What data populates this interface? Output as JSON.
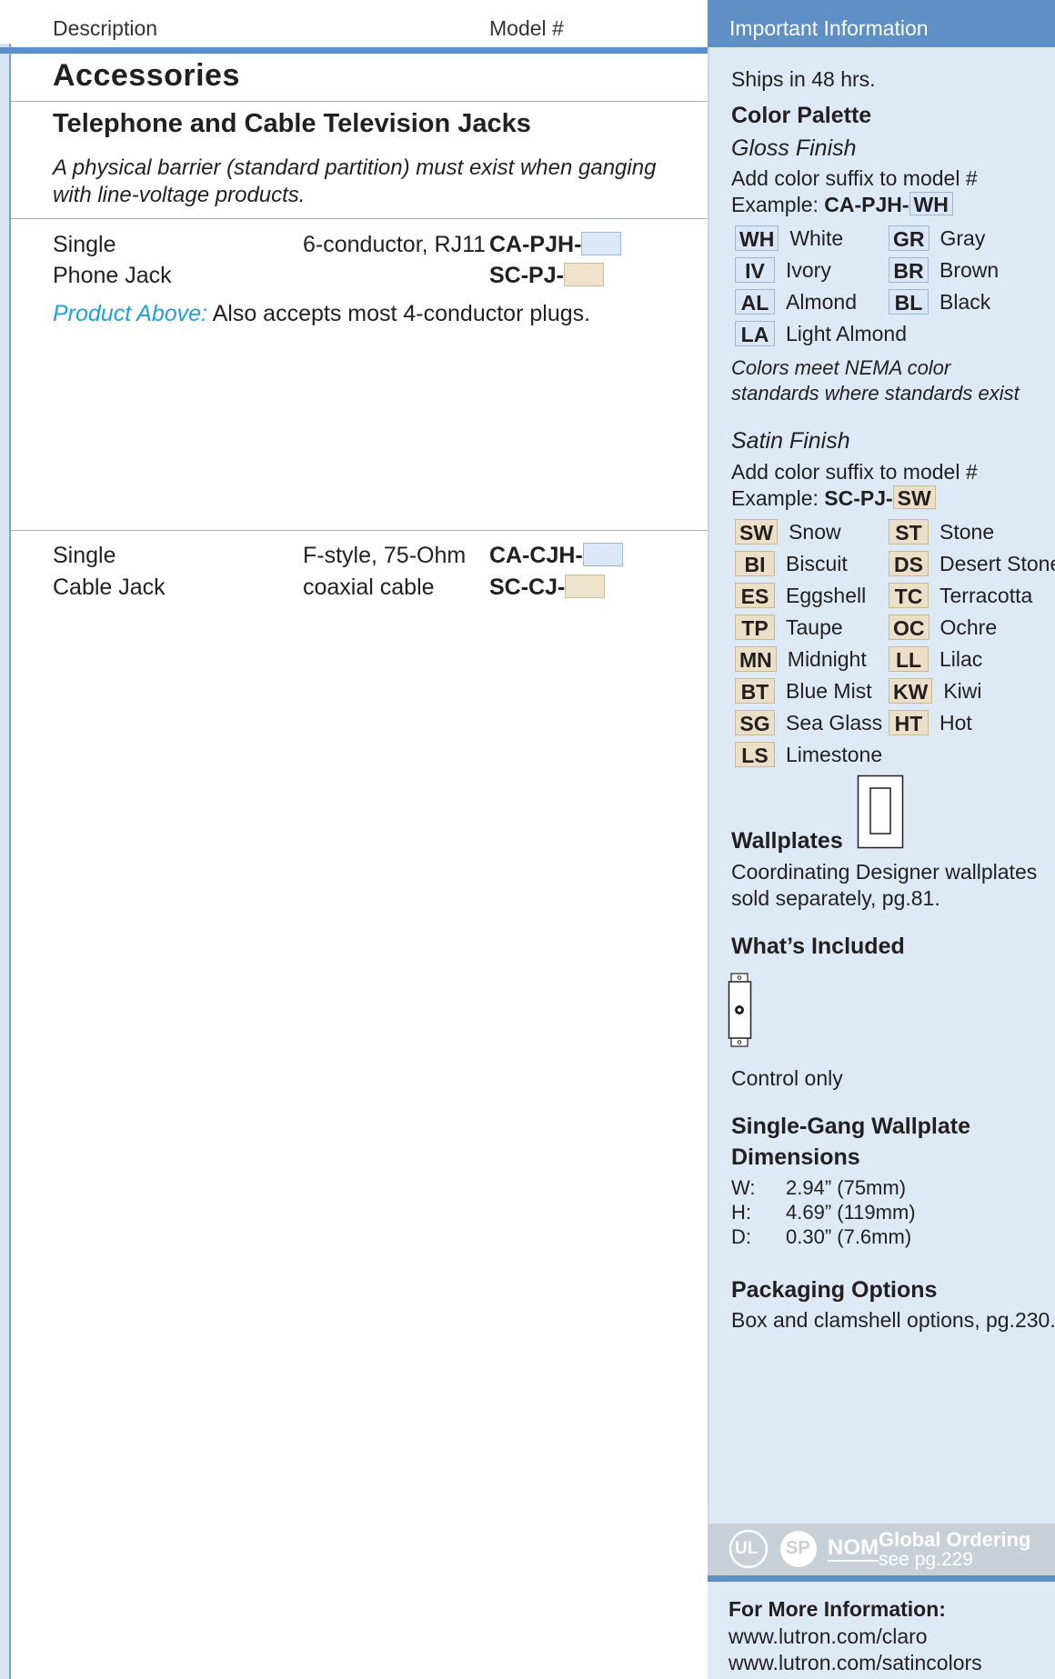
{
  "header": {
    "description_label": "Description",
    "model_label": "Model #",
    "info_label": "Important Information"
  },
  "main": {
    "section_title": "Accessories",
    "subsection_title": "Telephone and Cable Television Jacks",
    "note_line1": "A physical barrier (standard partition) must exist when ganging",
    "note_line2": "with line-voltage products.",
    "products": [
      {
        "name_line1": "Single",
        "name_line2": "Phone Jack",
        "spec_line1": "6-conductor, RJ11",
        "spec_line2": "",
        "model_gloss": "CA-PJH-",
        "model_satin": "SC-PJ-",
        "note_label": "Product Above:",
        "note_text": "Also accepts most 4-conductor plugs."
      },
      {
        "name_line1": "Single",
        "name_line2": "Cable Jack",
        "spec_line1": "F-style, 75-Ohm",
        "spec_line2": "coaxial cable",
        "model_gloss": "CA-CJH-",
        "model_satin": "SC-CJ-"
      }
    ]
  },
  "side": {
    "ships": "Ships in 48 hrs.",
    "palette_title": "Color Palette",
    "gloss": {
      "title": "Gloss Finish",
      "instruction": "Add color suffix to model #",
      "example_label": "Example:",
      "example_model": "CA-PJH-",
      "example_suffix": "WH",
      "colors": [
        {
          "code": "WH",
          "name": "White"
        },
        {
          "code": "IV",
          "name": "Ivory"
        },
        {
          "code": "AL",
          "name": "Almond"
        },
        {
          "code": "LA",
          "name": "Light Almond"
        },
        {
          "code": "GR",
          "name": "Gray"
        },
        {
          "code": "BR",
          "name": "Brown"
        },
        {
          "code": "BL",
          "name": "Black"
        }
      ],
      "note_line1": "Colors meet NEMA color",
      "note_line2": "standards where standards exist"
    },
    "satin": {
      "title": "Satin Finish",
      "instruction": "Add color suffix to model #",
      "example_label": "Example:",
      "example_model": "SC-PJ-",
      "example_suffix": "SW",
      "colors": [
        {
          "code": "SW",
          "name": "Snow"
        },
        {
          "code": "BI",
          "name": "Biscuit"
        },
        {
          "code": "ES",
          "name": "Eggshell"
        },
        {
          "code": "TP",
          "name": "Taupe"
        },
        {
          "code": "MN",
          "name": "Midnight"
        },
        {
          "code": "BT",
          "name": "Blue Mist"
        },
        {
          "code": "SG",
          "name": "Sea Glass"
        },
        {
          "code": "LS",
          "name": "Limestone"
        },
        {
          "code": "ST",
          "name": "Stone"
        },
        {
          "code": "DS",
          "name": "Desert Stone"
        },
        {
          "code": "TC",
          "name": "Terracotta"
        },
        {
          "code": "OC",
          "name": "Ochre"
        },
        {
          "code": "LL",
          "name": "Lilac"
        },
        {
          "code": "KW",
          "name": "Kiwi"
        },
        {
          "code": "HT",
          "name": "Hot"
        }
      ]
    },
    "wallplates": {
      "title": "Wallplates",
      "line1": "Coordinating Designer wallplates",
      "line2": "sold separately, pg.81."
    },
    "included": {
      "title": "What’s Included",
      "caption": "Control only"
    },
    "dimensions": {
      "title_line1": "Single-Gang Wallplate",
      "title_line2": "Dimensions",
      "rows": [
        {
          "label": "W:",
          "value": "2.94” (75mm)"
        },
        {
          "label": "H:",
          "value": "4.69” (119mm)"
        },
        {
          "label": "D:",
          "value": "0.30” (7.6mm)"
        }
      ]
    },
    "packaging": {
      "title": "Packaging Options",
      "text": "Box and clamshell options, pg.230."
    },
    "ordering": {
      "ul_mark": "UL",
      "csa_mark": "SP",
      "nom_mark": "NOM",
      "title": "Global Ordering",
      "see": "see pg.229"
    },
    "more_info": {
      "title": "For More Information:",
      "url1": "www.lutron.com/claro",
      "url2": "www.lutron.com/satincolors"
    }
  },
  "colors": {
    "accent_blue": "#5e8fc5",
    "panel_bg": "#dde9f5",
    "gloss_swatch": "#dbe8f7",
    "satin_swatch": "#efe3cc",
    "link_blue": "#1fa0d8"
  }
}
